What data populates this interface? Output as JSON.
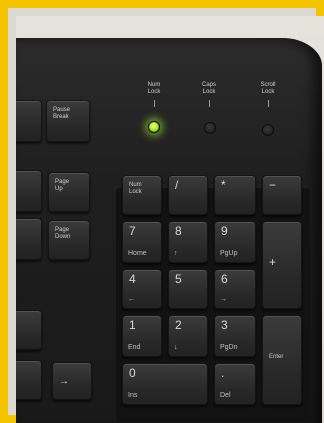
{
  "indicators": [
    {
      "label_1": "Num",
      "label_2": "Lock",
      "on": true
    },
    {
      "label_1": "Caps",
      "label_2": "Lock",
      "on": false
    },
    {
      "label_1": "Scroll",
      "label_2": "Lock",
      "on": false
    }
  ],
  "nav_keys": {
    "pause_1": "Pause",
    "pause_2": "Break",
    "pgup_1": "Page",
    "pgup_2": "Up",
    "pgdn_1": "Page",
    "pgdn_2": "Down",
    "right_arrow": "→"
  },
  "numpad": {
    "numlock_1": "Num",
    "numlock_2": "Lock",
    "divide": "/",
    "multiply": "*",
    "minus": "−",
    "plus": "+",
    "k7": "7",
    "k7_sub": "Home",
    "k8": "8",
    "k8_sub": "↑",
    "k9": "9",
    "k9_sub": "PgUp",
    "k4": "4",
    "k4_sub": "←",
    "k5": "5",
    "k6": "6",
    "k6_sub": "→",
    "k1": "1",
    "k1_sub": "End",
    "k2": "2",
    "k2_sub": "↓",
    "k3": "3",
    "k3_sub": "PgDn",
    "k0": "0",
    "k0_sub": "Ins",
    "dot": ".",
    "dot_sub": "Del",
    "enter": "Enter"
  }
}
